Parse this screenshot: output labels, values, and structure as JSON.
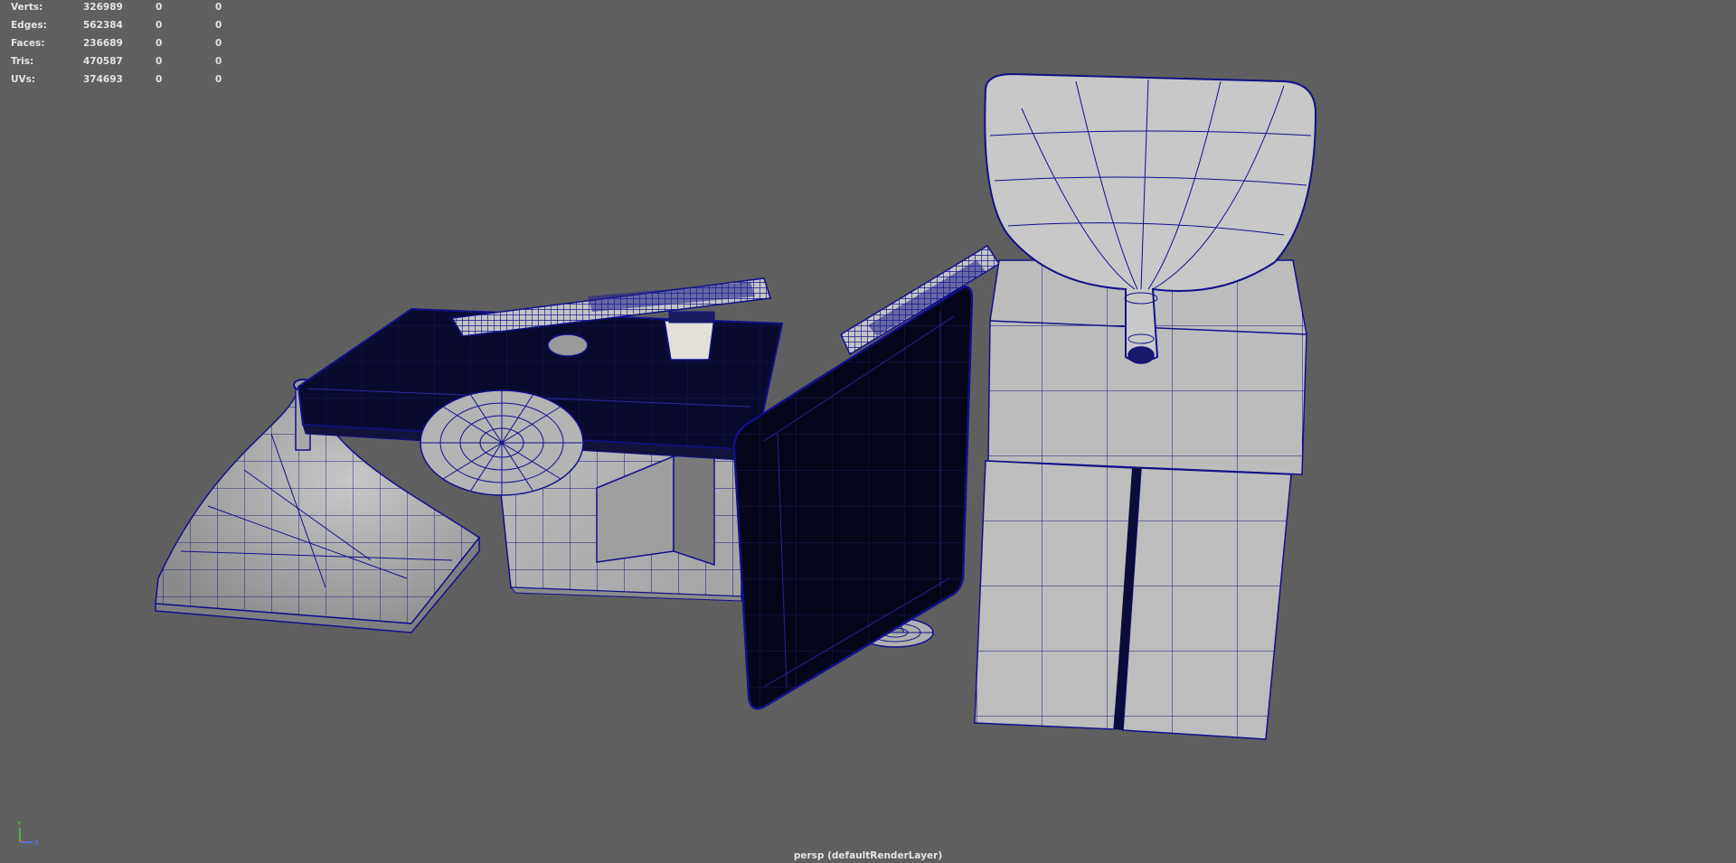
{
  "hud": {
    "rows": [
      {
        "label": "Verts:",
        "total": "326989",
        "selected": "0",
        "components": "0"
      },
      {
        "label": "Edges:",
        "total": "562384",
        "selected": "0",
        "components": "0"
      },
      {
        "label": "Faces:",
        "total": "236689",
        "selected": "0",
        "components": "0"
      },
      {
        "label": "Tris:",
        "total": "470587",
        "selected": "0",
        "components": "0"
      },
      {
        "label": "UVs:",
        "total": "374693",
        "selected": "0",
        "components": "0"
      }
    ]
  },
  "viewport": {
    "camera_label": "persp (defaultRenderLayer)",
    "background_color": "#5f5f5f",
    "wireframe_color": "#10108a"
  },
  "axis_gizmo": {
    "y_label": "Y",
    "z_label": "Z",
    "y_color": "#4ad04a",
    "z_color": "#5a7cff"
  }
}
